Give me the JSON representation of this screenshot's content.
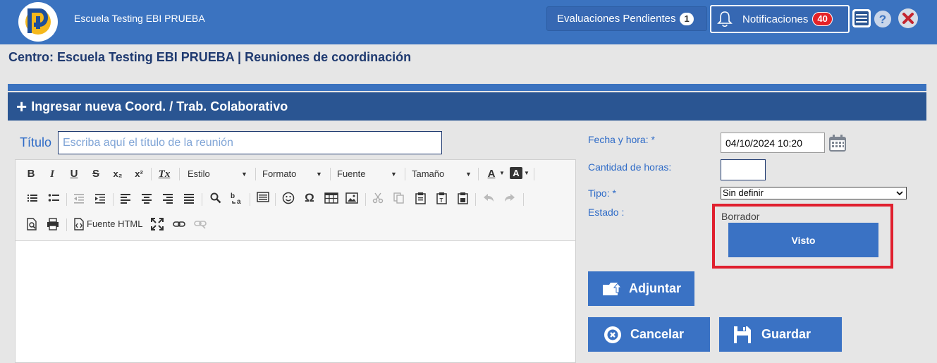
{
  "header": {
    "school_name": "Escuela Testing EBI PRUEBA",
    "eval_label": "Evaluaciones Pendientes",
    "eval_count": "1",
    "notif_label": "Notificaciones",
    "notif_count": "40",
    "colors": {
      "bar": "#3b73c0",
      "badge_red": "#e52227"
    }
  },
  "page": {
    "title": "Centro: Escuela Testing EBI PRUEBA | Reuniones de coordinación",
    "section_header": "Ingresar nueva Coord. / Trab. Colaborativo",
    "section_plus": "+"
  },
  "form": {
    "titulo_label": "Título",
    "titulo_placeholder": "Escriba aquí el título de la reunión",
    "fecha_label": "Fecha y hora: *",
    "fecha_value": "04/10/2024 10:20",
    "horas_label": "Cantidad de horas:",
    "horas_value": "",
    "tipo_label": "Tipo: *",
    "tipo_value": "Sin definir",
    "estado_label": "Estado :",
    "estado_value": "Borrador",
    "visto_button": "Visto",
    "adjuntar_button": "Adjuntar",
    "cancelar_button": "Cancelar",
    "guardar_button": "Guardar"
  },
  "editor": {
    "combos": {
      "estilo": "Estilo",
      "formato": "Formato",
      "fuente": "Fuente",
      "tamano": "Tamaño"
    },
    "source_label": "Fuente HTML",
    "glyphs": {
      "bold": "B",
      "italic": "I",
      "underline": "U",
      "strike": "S",
      "subscript": "x₂",
      "superscript": "x²",
      "remove_format": "Tx",
      "font_color": "A",
      "bg_color": "A",
      "special_char": "Ω"
    }
  }
}
